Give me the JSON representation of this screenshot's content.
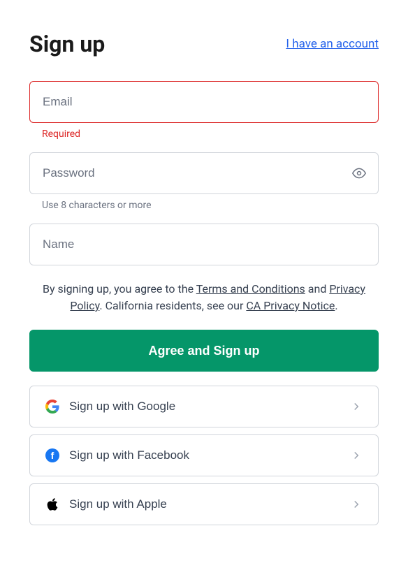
{
  "header": {
    "title": "Sign up",
    "account_link": "I have an account"
  },
  "fields": {
    "email": {
      "placeholder": "Email",
      "error": "Required"
    },
    "password": {
      "placeholder": "Password",
      "hint": "Use 8 characters or more"
    },
    "name": {
      "placeholder": "Name"
    }
  },
  "agreement": {
    "prefix": "By signing up, you agree to the ",
    "terms": "Terms and Conditions",
    "and": " and ",
    "privacy": "Privacy Policy",
    "ca_prefix": ". California residents, see our ",
    "ca_notice": "CA Privacy Notice",
    "suffix": "."
  },
  "primary_button": "Agree and Sign up",
  "social": {
    "google": "Sign up with Google",
    "facebook": "Sign up with Facebook",
    "apple": "Sign up with Apple"
  }
}
